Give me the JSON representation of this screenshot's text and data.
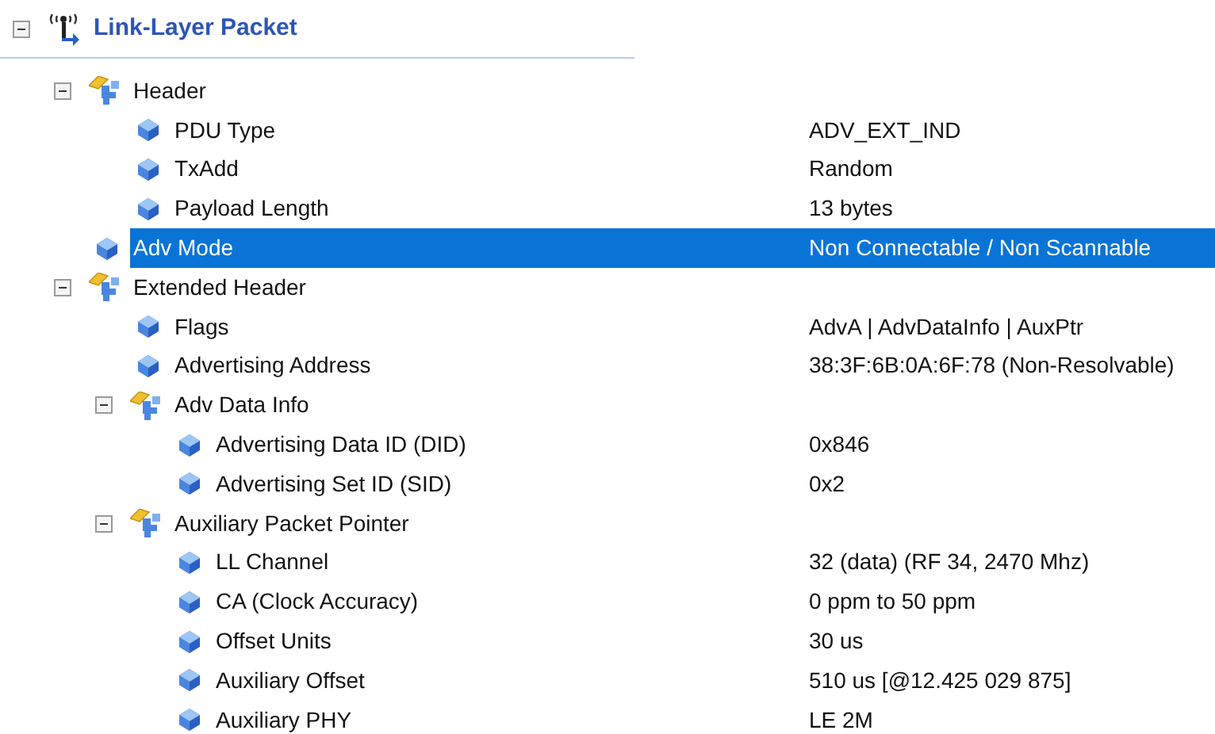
{
  "tree": {
    "label": "Link-Layer Packet",
    "expanded": true,
    "children": [
      {
        "kind": "group",
        "label": "Header",
        "expanded": true,
        "selected": false,
        "children": [
          {
            "kind": "field",
            "label": "PDU Type",
            "value": "ADV_EXT_IND",
            "selected": false
          },
          {
            "kind": "field",
            "label": "TxAdd",
            "value": "Random",
            "selected": false
          },
          {
            "kind": "field",
            "label": "Payload Length",
            "value": "13 bytes",
            "selected": false
          }
        ]
      },
      {
        "kind": "field",
        "label": "Adv Mode",
        "value": "Non Connectable / Non Scannable",
        "selected": true
      },
      {
        "kind": "group",
        "label": "Extended Header",
        "expanded": true,
        "selected": false,
        "children": [
          {
            "kind": "field",
            "label": "Flags",
            "value": "AdvA | AdvDataInfo | AuxPtr",
            "selected": false
          },
          {
            "kind": "field",
            "label": "Advertising Address",
            "value": "38:3F:6B:0A:6F:78 (Non-Resolvable)",
            "selected": false
          },
          {
            "kind": "group",
            "label": "Adv Data Info",
            "expanded": true,
            "selected": false,
            "children": [
              {
                "kind": "field",
                "label": "Advertising Data ID (DID)",
                "value": "0x846",
                "selected": false
              },
              {
                "kind": "field",
                "label": "Advertising Set ID (SID)",
                "value": "0x2",
                "selected": false
              }
            ]
          },
          {
            "kind": "group",
            "label": "Auxiliary Packet Pointer",
            "expanded": true,
            "selected": false,
            "children": [
              {
                "kind": "field",
                "label": "LL Channel",
                "value": "32 (data) (RF 34, 2470 Mhz)",
                "selected": false
              },
              {
                "kind": "field",
                "label": "CA (Clock Accuracy)",
                "value": "0 ppm to 50 ppm",
                "selected": false
              },
              {
                "kind": "field",
                "label": "Offset Units",
                "value": "30 us",
                "selected": false
              },
              {
                "kind": "field",
                "label": "Auxiliary Offset",
                "value": "510 us [@12.425 029 875]",
                "selected": false
              },
              {
                "kind": "field",
                "label": "Auxiliary PHY",
                "value": "LE 2M",
                "selected": false
              }
            ]
          }
        ]
      }
    ]
  }
}
